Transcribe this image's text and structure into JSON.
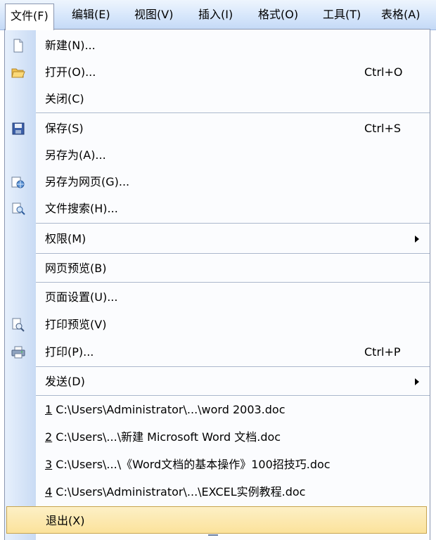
{
  "menubar": {
    "items": [
      {
        "label": "文件(F)"
      },
      {
        "label": "编辑(E)"
      },
      {
        "label": "视图(V)"
      },
      {
        "label": "插入(I)"
      },
      {
        "label": "格式(O)"
      },
      {
        "label": "工具(T)"
      },
      {
        "label": "表格(A)"
      }
    ]
  },
  "file_menu": {
    "new": {
      "label": "新建(N)...",
      "icon": "new-document-icon"
    },
    "open": {
      "label": "打开(O)...",
      "shortcut": "Ctrl+O",
      "icon": "open-folder-icon"
    },
    "close": {
      "label": "关闭(C)"
    },
    "save": {
      "label": "保存(S)",
      "shortcut": "Ctrl+S",
      "icon": "save-disk-icon"
    },
    "save_as": {
      "label": "另存为(A)..."
    },
    "save_as_web": {
      "label": "另存为网页(G)...",
      "icon": "web-page-icon"
    },
    "file_search": {
      "label": "文件搜索(H)...",
      "icon": "file-search-icon"
    },
    "permission": {
      "label": "权限(M)"
    },
    "web_preview": {
      "label": "网页预览(B)"
    },
    "page_setup": {
      "label": "页面设置(U)..."
    },
    "print_preview": {
      "label": "打印预览(V)",
      "icon": "print-preview-icon"
    },
    "print": {
      "label": "打印(P)...",
      "shortcut": "Ctrl+P",
      "icon": "printer-icon"
    },
    "send": {
      "label": "发送(D)"
    },
    "recent": [
      {
        "num": "1",
        "path": "C:\\Users\\Administrator\\...\\word 2003.doc"
      },
      {
        "num": "2",
        "path": "C:\\Users\\...\\新建 Microsoft Word 文档.doc"
      },
      {
        "num": "3",
        "path": "C:\\Users\\...\\《Word文档的基本操作》100招技巧.doc"
      },
      {
        "num": "4",
        "path": "C:\\Users\\Administrator\\...\\EXCEL实例教程.doc"
      }
    ],
    "exit": {
      "label": "退出(X)"
    }
  },
  "colors": {
    "menubar": "#d6e6fb",
    "icon_strip": "#c9dbf4",
    "highlight": "#fbe29b",
    "highlight_border": "#c7a44f"
  }
}
